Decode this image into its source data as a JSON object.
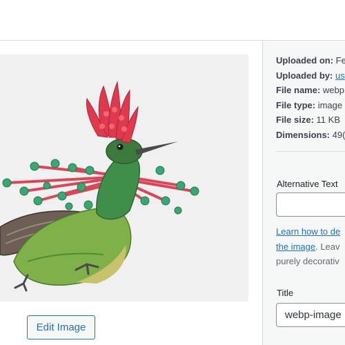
{
  "header": {
    "glyph": "'"
  },
  "media": {
    "image_alt": "Illustration of a hummingbird with a red crest",
    "edit_button_label": "Edit Image"
  },
  "details": {
    "uploaded_on_label": "Uploaded on:",
    "uploaded_on_value": "Fe",
    "uploaded_by_label": "Uploaded by:",
    "uploaded_by_value": "us",
    "file_name_label": "File name:",
    "file_name_value": "webp",
    "file_type_label": "File type:",
    "file_type_value": "image",
    "file_size_label": "File size:",
    "file_size_value": "11 KB",
    "dimensions_label": "Dimensions:",
    "dimensions_value": "49("
  },
  "alt_text": {
    "label": "Alternative Text",
    "value": "",
    "help_link_line1": "Learn how to de",
    "help_link_line2": "the image",
    "help_text_line2": ". Leav",
    "help_text_line3": "purely decorativ"
  },
  "title_field": {
    "label": "Title",
    "value": "webp-image"
  },
  "colors": {
    "accent": "#2271b1",
    "panel_bg": "#f6f7f7",
    "image_bg": "#f0f0f1",
    "crest": "#e0394d",
    "beads": "#3aa772"
  }
}
